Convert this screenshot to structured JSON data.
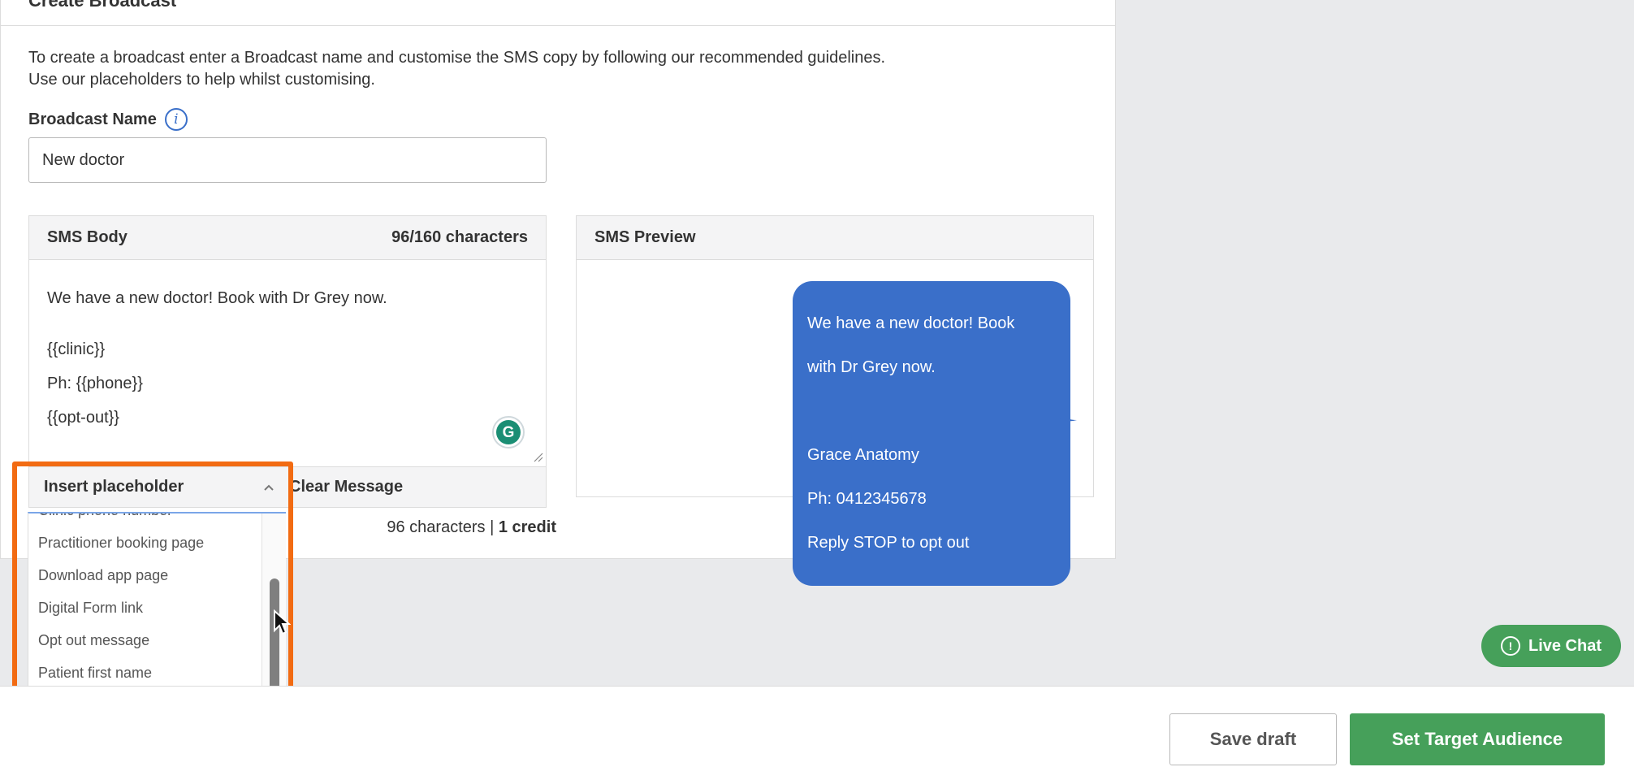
{
  "header": {
    "title": "Create Broadcast"
  },
  "intro": {
    "line1": "To create a broadcast enter a Broadcast name and customise the SMS copy by following our recommended guidelines.",
    "line2": "Use our placeholders to help whilst customising."
  },
  "broadcast_name": {
    "label": "Broadcast Name",
    "value": "New doctor"
  },
  "sms_body": {
    "title": "SMS Body",
    "char_count": "96/160 characters",
    "line1": "We have a new doctor! Book with Dr Grey now.",
    "line2": "{{clinic}}",
    "line3": "Ph: {{phone}}",
    "line4": "{{opt-out}}",
    "insert_placeholder_label": "Insert placeholder",
    "clear_label": "Clear Message"
  },
  "placeholder_options": [
    "Clinic phone number",
    "Practitioner booking page",
    "Download app page",
    "Digital Form link",
    "Opt out message",
    "Patient first name"
  ],
  "sms_preview": {
    "title": "SMS Preview",
    "message_line1": "We have a new doctor! Book",
    "message_line2": "with Dr Grey now.",
    "message_line3": "Grace Anatomy",
    "message_line4": "Ph: 0412345678",
    "message_line5": "Reply STOP to opt out"
  },
  "summary": {
    "chars": "96 characters",
    "separator": " | ",
    "credit": "1 credit"
  },
  "live_chat": {
    "label": "Live Chat"
  },
  "footer": {
    "save_draft": "Save draft",
    "set_target": "Set Target Audience"
  },
  "colors": {
    "accent_blue": "#3a6fc9",
    "green": "#46a05a",
    "highlight_orange": "#f26b12"
  }
}
